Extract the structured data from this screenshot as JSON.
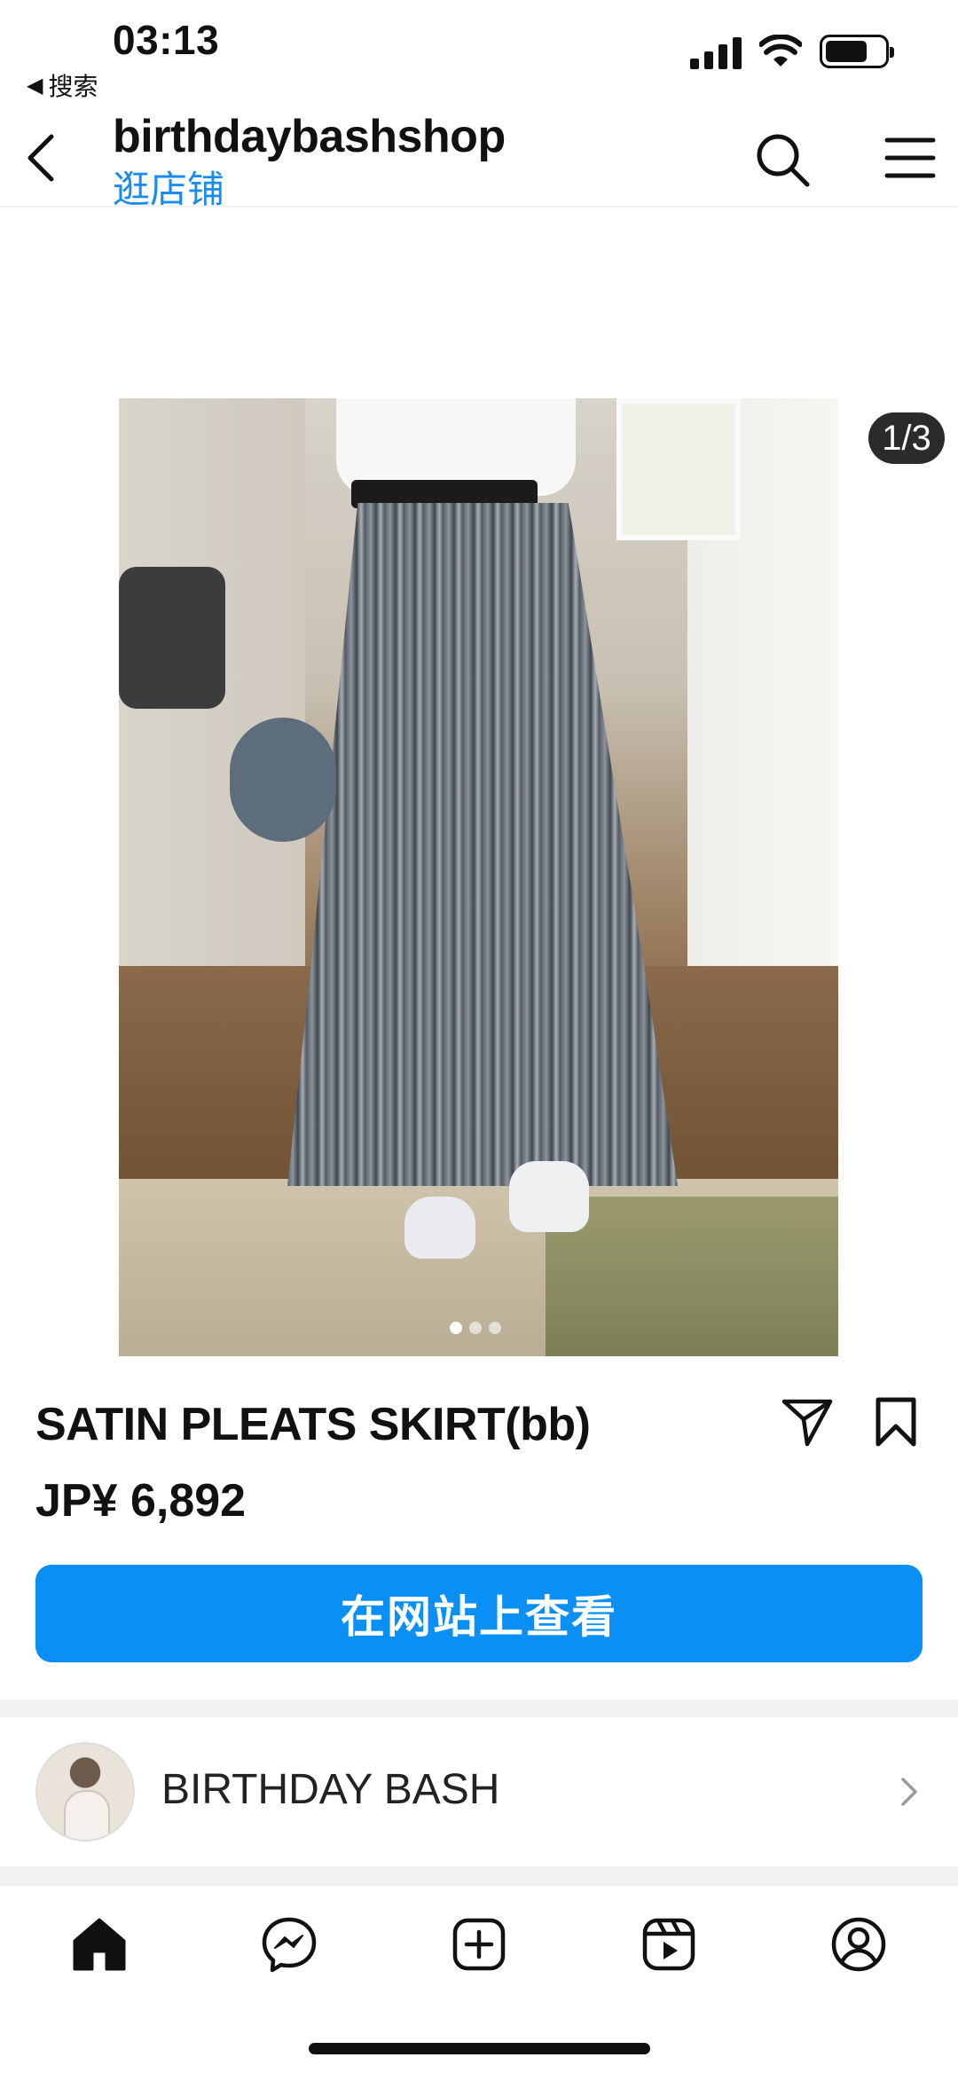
{
  "status_bar": {
    "time": "03:13",
    "back_label": "搜索"
  },
  "header": {
    "shop_name": "birthdaybashshop",
    "shop_link": "逛店铺",
    "icons": [
      "back-chevron-icon",
      "search-icon",
      "menu-icon"
    ]
  },
  "product": {
    "image_counter": "1/3",
    "carousel": {
      "count": 3,
      "active_index": 0
    },
    "title": "SATIN PLEATS SKIRT(bb)",
    "price": "JP¥ 6,892",
    "cta_label": "在网站上查看"
  },
  "seller": {
    "name": "BIRTHDAY BASH"
  },
  "bottom_nav": {
    "items": [
      "home-icon",
      "messenger-icon",
      "create-post-icon",
      "reels-icon",
      "profile-icon"
    ]
  },
  "colors": {
    "accent_blue": "#0a8ff5",
    "link_blue": "#1a8cf0",
    "text": "#111111",
    "counter_bg": "#2b2b2b"
  }
}
